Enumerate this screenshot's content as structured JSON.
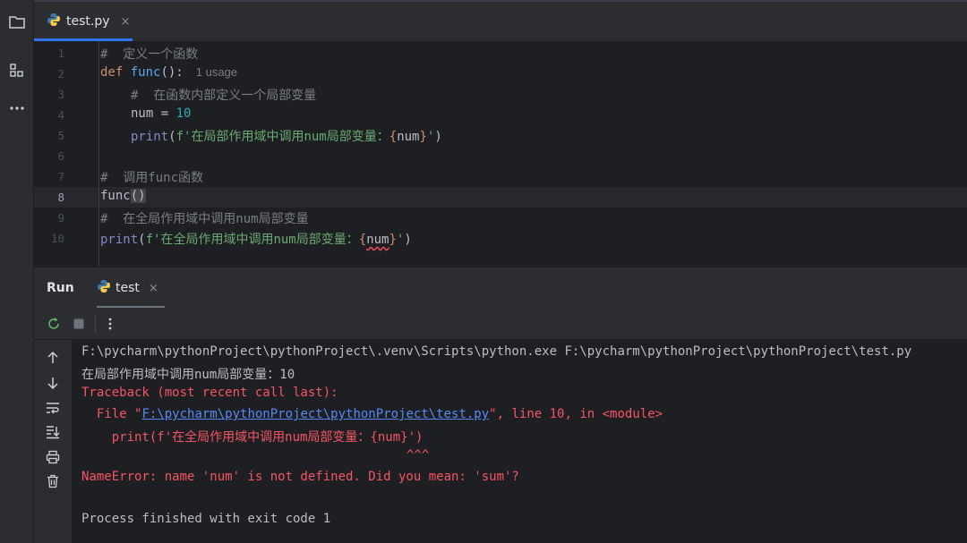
{
  "colors": {
    "accent": "#3574f0",
    "error": "#f75464",
    "link": "#548af7",
    "keyword": "#cf8e6d",
    "function": "#56a8f5",
    "number": "#2aacb8",
    "string": "#6aab73",
    "comment": "#7a7e85"
  },
  "activity_bar": {
    "icons": [
      "folder-icon",
      "structure-icon",
      "more-icon"
    ]
  },
  "editor_tab": {
    "filename": "test.py",
    "close": "×",
    "icon": "python-icon"
  },
  "editor": {
    "current_line": 8,
    "line_numbers": [
      "1",
      "2",
      "3",
      "4",
      "5",
      "6",
      "7",
      "8",
      "9",
      "10"
    ],
    "line1": {
      "text": "#  定义一个函数"
    },
    "line2": {
      "kw": "def",
      "fn": "func",
      "punct": "():",
      "hint": "1 usage"
    },
    "line3": {
      "text": "#  在函数内部定义一个局部变量"
    },
    "line4": {
      "name": "num",
      "op": " = ",
      "value": "10"
    },
    "line5": {
      "call": "print",
      "open": "(",
      "fprefix": "f'",
      "str": "在局部作用域中调用num局部变量：",
      "lbrace": "{",
      "var": "num",
      "rbrace": "}",
      "quote": "'",
      "close": ")"
    },
    "line7": {
      "text": "#  调用func函数"
    },
    "line8": {
      "fn": "func",
      "open": "(",
      "close": ")"
    },
    "line9": {
      "text": "#  在全局作用域中调用num局部变量"
    },
    "line10": {
      "call": "print",
      "open": "(",
      "fprefix": "f'",
      "str": "在全局作用域中调用num局部变量：",
      "lbrace": "{",
      "var": "num",
      "rbrace": "}",
      "quote": "'",
      "close": ")"
    }
  },
  "run_panel": {
    "title": "Run",
    "tab_label": "test",
    "tab_close": "×",
    "toolbar": [
      "rerun-icon",
      "stop-icon",
      "more-vertical-icon"
    ],
    "side_toolbar": [
      "scroll-up-icon",
      "scroll-down-icon",
      "soft-wrap-icon",
      "scroll-to-end-icon",
      "print-icon",
      "clear-icon"
    ]
  },
  "console": {
    "command": "F:\\pycharm\\pythonProject\\pythonProject\\.venv\\Scripts\\python.exe F:\\pycharm\\pythonProject\\pythonProject\\test.py",
    "output1": "在局部作用域中调用num局部变量：10",
    "traceback_header": "Traceback (most recent call last):",
    "file_prefix": "  File \"",
    "file_path": "F:\\pycharm\\pythonProject\\pythonProject\\test.py",
    "file_suffix": "\", line 10, in <module>",
    "code_line": "    print(f'在全局作用域中调用num局部变量：{num}')",
    "caret_line": "                                       ^^^",
    "error": "NameError: name 'num' is not defined. Did you mean: 'sum'?",
    "finish": "Process finished with exit code 1"
  }
}
